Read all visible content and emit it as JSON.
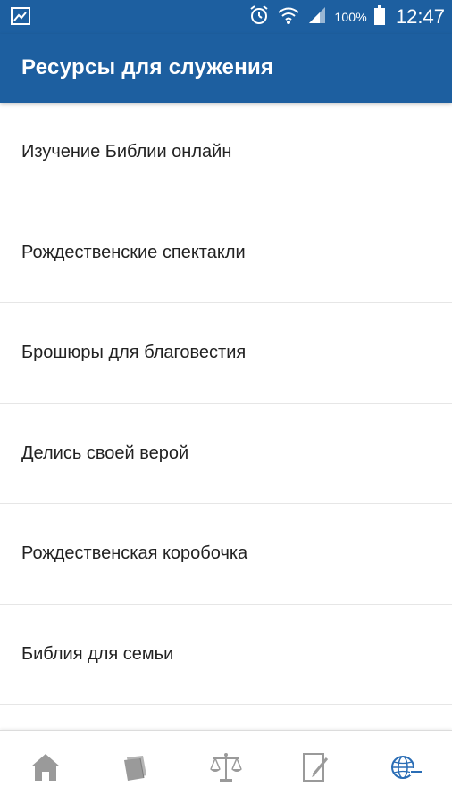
{
  "status_bar": {
    "battery_percent": "100%",
    "time": "12:47",
    "icons": [
      "gallery-icon",
      "alarm-icon",
      "wifi-icon",
      "signal-icon",
      "battery-icon"
    ]
  },
  "app_bar": {
    "title": "Ресурсы для служения"
  },
  "list": {
    "items": [
      {
        "label": "Изучение Библии онлайн"
      },
      {
        "label": "Рождественские спектакли"
      },
      {
        "label": "Брошюры для благовестия"
      },
      {
        "label": "Делись своей верой"
      },
      {
        "label": "Рождественская коробочка"
      },
      {
        "label": "Библия для семьи"
      }
    ]
  },
  "bottom_nav": {
    "items": [
      {
        "icon": "home-icon"
      },
      {
        "icon": "books-icon"
      },
      {
        "icon": "scales-icon"
      },
      {
        "icon": "edit-note-icon"
      },
      {
        "icon": "globe-logo-icon"
      }
    ]
  },
  "colors": {
    "primary": "#1d5fa0",
    "icon_gray": "#9a9a9a",
    "icon_blue": "#2a6db5",
    "text": "#222222",
    "divider": "#e6e6e6"
  }
}
